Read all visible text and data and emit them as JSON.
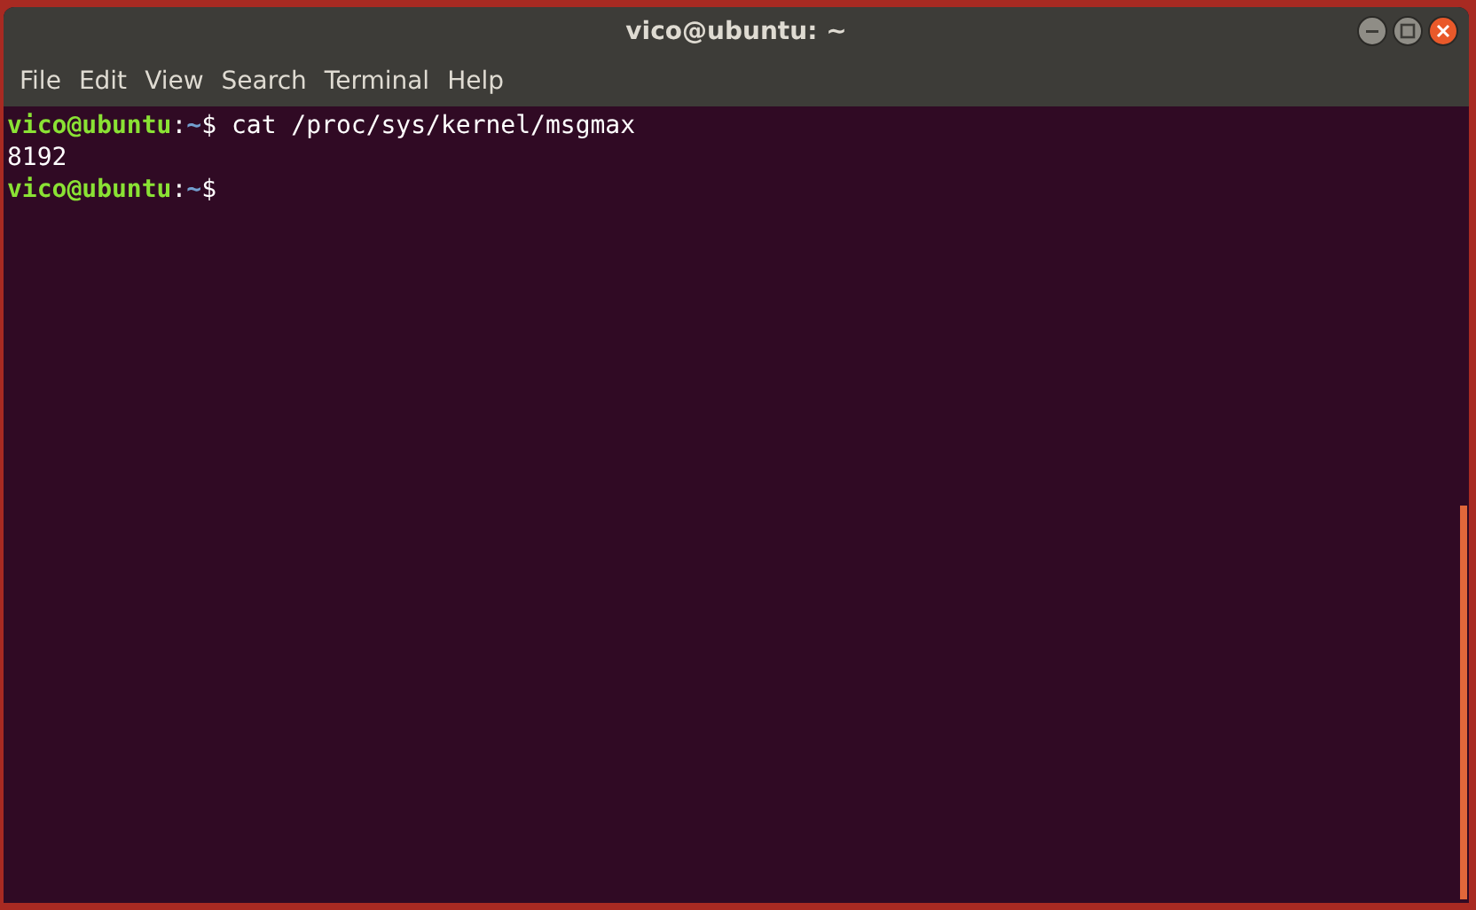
{
  "window": {
    "title": "vico@ubuntu: ~"
  },
  "menu": [
    {
      "label": "File"
    },
    {
      "label": "Edit"
    },
    {
      "label": "View"
    },
    {
      "label": "Search"
    },
    {
      "label": "Terminal"
    },
    {
      "label": "Help"
    }
  ],
  "terminal": {
    "lines": [
      {
        "kind": "prompt",
        "user_host": "vico@ubuntu",
        "separator": ":",
        "path": "~",
        "symbol": "$",
        "command": "cat /proc/sys/kernel/msgmax"
      },
      {
        "kind": "output",
        "text": "8192"
      },
      {
        "kind": "prompt",
        "user_host": "vico@ubuntu",
        "separator": ":",
        "path": "~",
        "symbol": "$"
      }
    ]
  }
}
